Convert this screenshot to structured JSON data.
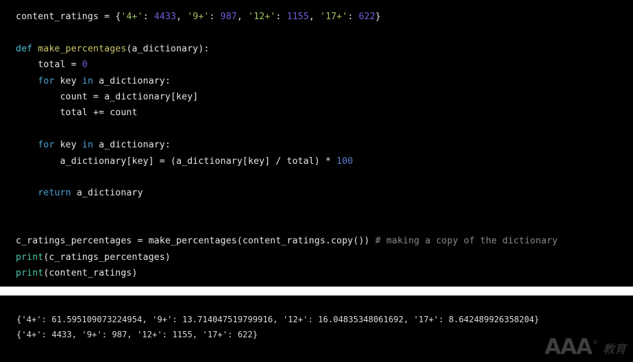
{
  "theme": {
    "editor_background": "#000000",
    "console_background": "#000000",
    "gap_background": "#ffffff",
    "default_text": "#e8e8e8",
    "keyword_color": "#4aa5d8",
    "def_color": "#4fc1d6",
    "function_name_color": "#cdc96a",
    "builtin_color": "#4ec9b0",
    "string_color": "#a2c261",
    "number_color": "#6a63d8",
    "comment_color": "#8a8a8a"
  },
  "editor": {
    "language": "python",
    "lines": [
      [
        {
          "t": "content_ratings ",
          "c": "tok-plain"
        },
        {
          "t": "= ",
          "c": "tok-op"
        },
        {
          "t": "{",
          "c": "tok-punct"
        },
        {
          "t": "'4+'",
          "c": "tok-str"
        },
        {
          "t": ": ",
          "c": "tok-punct"
        },
        {
          "t": "4433",
          "c": "tok-num"
        },
        {
          "t": ", ",
          "c": "tok-punct"
        },
        {
          "t": "'9+'",
          "c": "tok-str"
        },
        {
          "t": ": ",
          "c": "tok-punct"
        },
        {
          "t": "987",
          "c": "tok-num"
        },
        {
          "t": ", ",
          "c": "tok-punct"
        },
        {
          "t": "'12+'",
          "c": "tok-str"
        },
        {
          "t": ": ",
          "c": "tok-punct"
        },
        {
          "t": "1155",
          "c": "tok-num"
        },
        {
          "t": ", ",
          "c": "tok-punct"
        },
        {
          "t": "'17+'",
          "c": "tok-str"
        },
        {
          "t": ": ",
          "c": "tok-punct"
        },
        {
          "t": "622",
          "c": "tok-num"
        },
        {
          "t": "}",
          "c": "tok-punct"
        }
      ],
      [],
      [
        {
          "t": "def ",
          "c": "tok-def"
        },
        {
          "t": "make_percentages",
          "c": "tok-fnname"
        },
        {
          "t": "(a_dictionary):",
          "c": "tok-plain"
        }
      ],
      [
        {
          "t": "    total ",
          "c": "tok-plain"
        },
        {
          "t": "= ",
          "c": "tok-op"
        },
        {
          "t": "0",
          "c": "tok-num"
        }
      ],
      [
        {
          "t": "    ",
          "c": "tok-plain"
        },
        {
          "t": "for ",
          "c": "tok-kw"
        },
        {
          "t": "key ",
          "c": "tok-plain"
        },
        {
          "t": "in ",
          "c": "tok-kw"
        },
        {
          "t": "a_dictionary:",
          "c": "tok-plain"
        }
      ],
      [
        {
          "t": "        count = a_dictionary[key]",
          "c": "tok-plain"
        }
      ],
      [
        {
          "t": "        total += count",
          "c": "tok-plain"
        }
      ],
      [],
      [
        {
          "t": "    ",
          "c": "tok-plain"
        },
        {
          "t": "for ",
          "c": "tok-kw"
        },
        {
          "t": "key ",
          "c": "tok-plain"
        },
        {
          "t": "in ",
          "c": "tok-kw"
        },
        {
          "t": "a_dictionary:",
          "c": "tok-plain"
        }
      ],
      [
        {
          "t": "        a_dictionary[key] = (a_dictionary[key] / total) * ",
          "c": "tok-plain"
        },
        {
          "t": "100",
          "c": "tok-num2"
        }
      ],
      [],
      [
        {
          "t": "    ",
          "c": "tok-plain"
        },
        {
          "t": "return ",
          "c": "tok-kw"
        },
        {
          "t": "a_dictionary",
          "c": "tok-plain"
        }
      ],
      [],
      [],
      [
        {
          "t": "c_ratings_percentages ",
          "c": "tok-plain"
        },
        {
          "t": "= ",
          "c": "tok-op"
        },
        {
          "t": "make_percentages(content_ratings.copy()) ",
          "c": "tok-plain"
        },
        {
          "t": "# making a copy of the dictionary",
          "c": "tok-comment"
        }
      ],
      [
        {
          "t": "print",
          "c": "tok-builtin"
        },
        {
          "t": "(c_ratings_percentages)",
          "c": "tok-plain"
        }
      ],
      [
        {
          "t": "print",
          "c": "tok-builtin"
        },
        {
          "t": "(content_ratings)",
          "c": "tok-plain"
        }
      ]
    ]
  },
  "console": {
    "lines": [
      "{'4+': 61.595109073224954, '9+': 13.714047519799916, '12+': 16.04835348061692, '17+': 8.642489926358204}",
      "{'4+': 4433, '9+': 987, '12+': 1155, '17+': 622}"
    ]
  },
  "watermark": {
    "mark": "AAA",
    "registered": "®",
    "suffix": "教育"
  }
}
